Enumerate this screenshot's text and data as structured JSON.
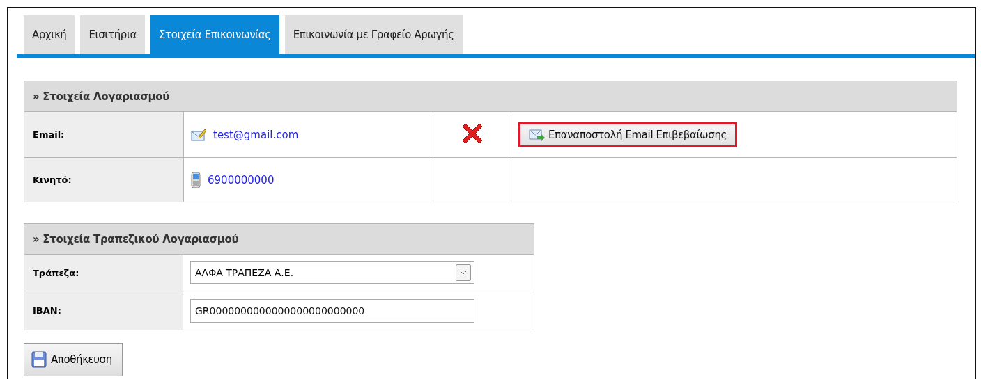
{
  "tabs": [
    {
      "label": "Αρχική",
      "selected": false
    },
    {
      "label": "Εισιτήρια",
      "selected": false
    },
    {
      "label": "Στοιχεία Επικοινωνίας",
      "selected": true
    },
    {
      "label": "Επικοινωνία με Γραφείο Αρωγής",
      "selected": false
    }
  ],
  "account": {
    "title": "» Στοιχεία Λογαριασμού",
    "rows": [
      {
        "kind": "email",
        "label": "Email:",
        "value": "test@gmail.com",
        "verified": false,
        "action": "Επαναποστολή Email Επιβεβαίωσης",
        "action_highlighted": true
      },
      {
        "kind": "phone",
        "label": "Κινητό:",
        "value": "6900000000"
      }
    ]
  },
  "bank": {
    "title": "» Στοιχεία Τραπεζικού Λογαριασμού",
    "rows": [
      {
        "kind": "select",
        "label": "Τράπεζα:",
        "value": "ΑΛΦΑ ΤΡΑΠΕΖΑ Α.Ε."
      },
      {
        "kind": "input",
        "label": "IBAN:",
        "value": "GR0000000000000000000000000"
      }
    ]
  },
  "save_button": "Αποθήκευση"
}
